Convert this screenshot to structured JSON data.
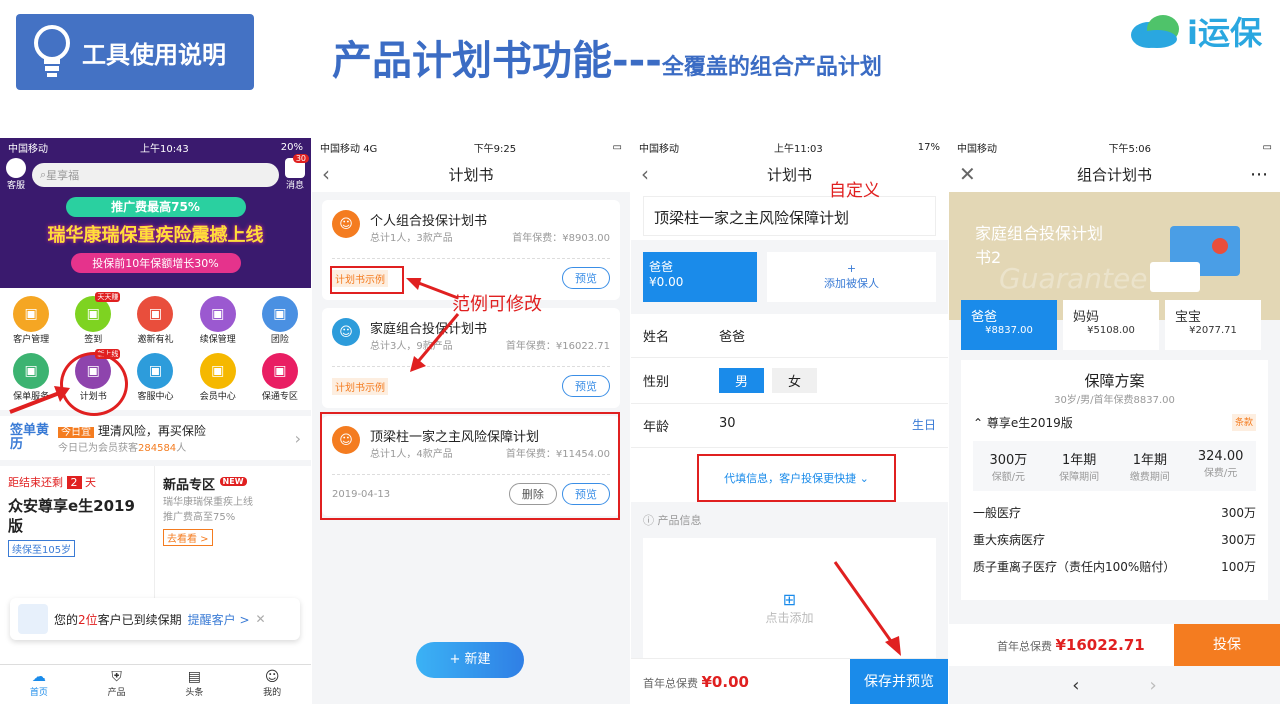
{
  "header": {
    "badge": "工具使用说明",
    "title": "产品计划书功能---",
    "subtitle": "全覆盖的组合产品计划",
    "logo_text": "i运保"
  },
  "p1": {
    "carrier": "中国移动",
    "time": "上午10:43",
    "battery": "20%",
    "kefu": "客服",
    "search": "星享福",
    "msg": "消息",
    "msg_count": "30",
    "promo1": "推广费最高75%",
    "promo2": "瑞华康瑞保重疾险震撼上线",
    "promo3": "投保前10年保额增长30%",
    "grid": [
      {
        "label": "客户管理",
        "color": "#f5a623"
      },
      {
        "label": "签到",
        "color": "#7ed321",
        "tag": "天天赚"
      },
      {
        "label": "邀新有礼",
        "color": "#e94e3c"
      },
      {
        "label": "续保管理",
        "color": "#9b59d0"
      },
      {
        "label": "团险",
        "color": "#4a90e2"
      },
      {
        "label": "保单服务",
        "color": "#3cb371"
      },
      {
        "label": "计划书",
        "color": "#8e44ad",
        "tag": "新上线"
      },
      {
        "label": "客服中心",
        "color": "#2d9cdb"
      },
      {
        "label": "会员中心",
        "color": "#f5b800"
      },
      {
        "label": "保通专区",
        "color": "#e91e63"
      }
    ],
    "calendar_logo": "签单黄历",
    "today_tag": "今日宜",
    "today_text": "理清风险，再买保险",
    "member_text": "今日已为会员获客",
    "member_count": "284584",
    "member_unit": "人",
    "countdown": "距结束还剩",
    "days": "2",
    "day_unit": "天",
    "product": "众安尊享e生2019版",
    "renew": "续保至105岁",
    "new_zone": "新品专区",
    "new_tag": "NEW",
    "new_desc1": "瑞华康瑞保重疾上线",
    "new_desc2": "推广费高至75%",
    "see": "去看看 >",
    "notice_pre": "您的",
    "notice_num": "2位",
    "notice_post": "客户已到续保期",
    "notice_btn": "提醒客户 >",
    "tabs": [
      "首页",
      "产品",
      "头条",
      "我的"
    ]
  },
  "p2": {
    "carrier": "中国移动",
    "net": "4G",
    "time": "下午9:25",
    "title": "计划书",
    "cards": [
      {
        "name": "个人组合投保计划书",
        "meta": "总计1人，3款产品",
        "premium": "首年保费：¥8903.00",
        "tag": "计划书示例",
        "btn": "预览"
      },
      {
        "name": "家庭组合投保计划书",
        "meta": "总计3人，9款产品",
        "premium": "首年保费：¥16022.71",
        "tag": "计划书示例",
        "btn": "预览"
      },
      {
        "name": "顶梁柱一家之主风险保障计划",
        "meta": "总计1人，4款产品",
        "premium": "首年保费：¥11454.00",
        "date": "2019-04-13",
        "del": "删除",
        "btn": "预览"
      }
    ],
    "annotation": "范例可修改",
    "new_btn": "+ 新建"
  },
  "p3": {
    "carrier": "中国移动",
    "time": "上午11:03",
    "battery": "17%",
    "title": "计划书",
    "annotation": "自定义",
    "plan_name": "顶梁柱一家之主风险保障计划",
    "insured": "爸爸",
    "amount": "¥0.00",
    "add_plus": "+",
    "add": "添加被保人",
    "name_label": "姓名",
    "name_val": "爸爸",
    "gender_label": "性别",
    "male": "男",
    "female": "女",
    "age_label": "年龄",
    "age_val": "30",
    "birthday": "生日",
    "fill_hint": "代填信息，客户投保更快捷",
    "product_info": "产品信息",
    "click_add": "点击添加",
    "total_label": "首年总保费",
    "total": "¥0.00",
    "save": "保存并预览"
  },
  "p4": {
    "carrier": "中国移动",
    "time": "下午5:06",
    "title": "组合计划书",
    "banner1": "家庭组合投保计划",
    "banner2": "书2",
    "watermark": "Guarantee",
    "members": [
      {
        "name": "爸爸",
        "amt": "¥8837.00"
      },
      {
        "name": "妈妈",
        "amt": "¥5108.00"
      },
      {
        "name": "宝宝",
        "amt": "¥2077.71"
      }
    ],
    "plan_title": "保障方案",
    "plan_sub": "30岁/男/首年保费8837.00",
    "product": "尊享e生2019版",
    "clause": "条款",
    "stats": [
      {
        "v": "300万",
        "l": "保额/元"
      },
      {
        "v": "1年期",
        "l": "保障期间"
      },
      {
        "v": "1年期",
        "l": "缴费期间"
      },
      {
        "v": "324.00",
        "l": "保费/元"
      }
    ],
    "items": [
      {
        "n": "一般医疗",
        "v": "300万"
      },
      {
        "n": "重大疾病医疗",
        "v": "300万"
      },
      {
        "n": "质子重离子医疗（责任内100%赔付）",
        "v": "100万"
      }
    ],
    "total_label": "首年总保费",
    "total": "¥16022.71",
    "buy": "投保"
  }
}
